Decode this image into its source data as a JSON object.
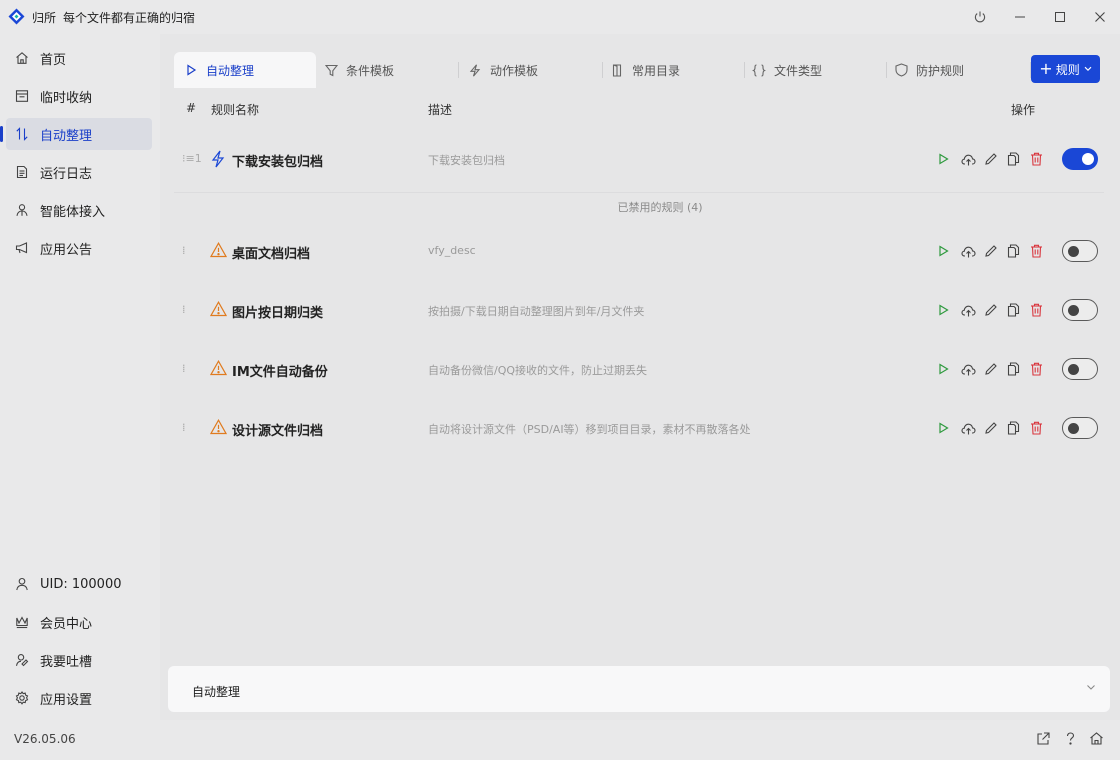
{
  "app": {
    "name": "归所",
    "slogan": "每个文件都有正确的归宿",
    "version": "V26.05.06",
    "accent": "#1a47d6",
    "logo": "app-logo-diamond"
  },
  "window_controls": [
    "power-icon",
    "minimize-icon",
    "maximize-icon",
    "close-icon"
  ],
  "sidebar": {
    "items": [
      {
        "label": "首页",
        "icon": "home-icon"
      },
      {
        "label": "临时收纳",
        "icon": "inbox-icon"
      },
      {
        "label": "自动整理",
        "icon": "sort-arrows-icon",
        "active": true
      },
      {
        "label": "运行日志",
        "icon": "log-icon"
      },
      {
        "label": "智能体接入",
        "icon": "agent-icon"
      },
      {
        "label": "应用公告",
        "icon": "megaphone-icon"
      }
    ],
    "footer_items": [
      {
        "label": "UID: 100000",
        "icon": "user-icon"
      },
      {
        "label": "会员中心",
        "icon": "crown-icon"
      },
      {
        "label": "我要吐槽",
        "icon": "feedback-icon"
      },
      {
        "label": "应用设置",
        "icon": "gear-icon"
      }
    ]
  },
  "tabs": [
    {
      "label": "自动整理",
      "icon": "play-icon",
      "active": true
    },
    {
      "label": "条件模板",
      "icon": "filter-icon"
    },
    {
      "label": "动作模板",
      "icon": "lightning-icon"
    },
    {
      "label": "常用目录",
      "icon": "door-icon"
    },
    {
      "label": "文件类型",
      "icon": "braces-icon"
    },
    {
      "label": "防护规则",
      "icon": "shield-icon"
    }
  ],
  "add_rule_button": "规则",
  "table": {
    "headers": {
      "index": "#",
      "name": "规则名称",
      "desc": "描述",
      "actions": "操作"
    },
    "enabled_rules": [
      {
        "index": "1",
        "name": "下载安装包归档",
        "desc": "下载安装包归档",
        "icon": "lightning-icon",
        "enabled": true
      }
    ],
    "disabled_label": "已禁用的规则 (4)",
    "disabled_rules": [
      {
        "name": "桌面文档归档",
        "desc": "vfy_desc",
        "icon": "warning-icon",
        "enabled": false
      },
      {
        "name": "图片按日期归类",
        "desc": "按拍摄/下载日期自动整理图片到年/月文件夹",
        "icon": "warning-icon",
        "enabled": false
      },
      {
        "name": "IM文件自动备份",
        "desc": "自动备份微信/QQ接收的文件，防止过期丢失",
        "icon": "warning-icon",
        "enabled": false
      },
      {
        "name": "设计源文件归档",
        "desc": "自动将设计源文件（PSD/AI等）移到项目目录，素材不再散落各处",
        "icon": "warning-icon",
        "enabled": false
      }
    ],
    "row_actions": [
      "run-icon",
      "upload-icon",
      "edit-icon",
      "copy-icon",
      "delete-icon"
    ]
  },
  "log_panel": {
    "title": "自动整理"
  },
  "bottom_icons": [
    "share-icon",
    "help-icon",
    "home-icon"
  ]
}
